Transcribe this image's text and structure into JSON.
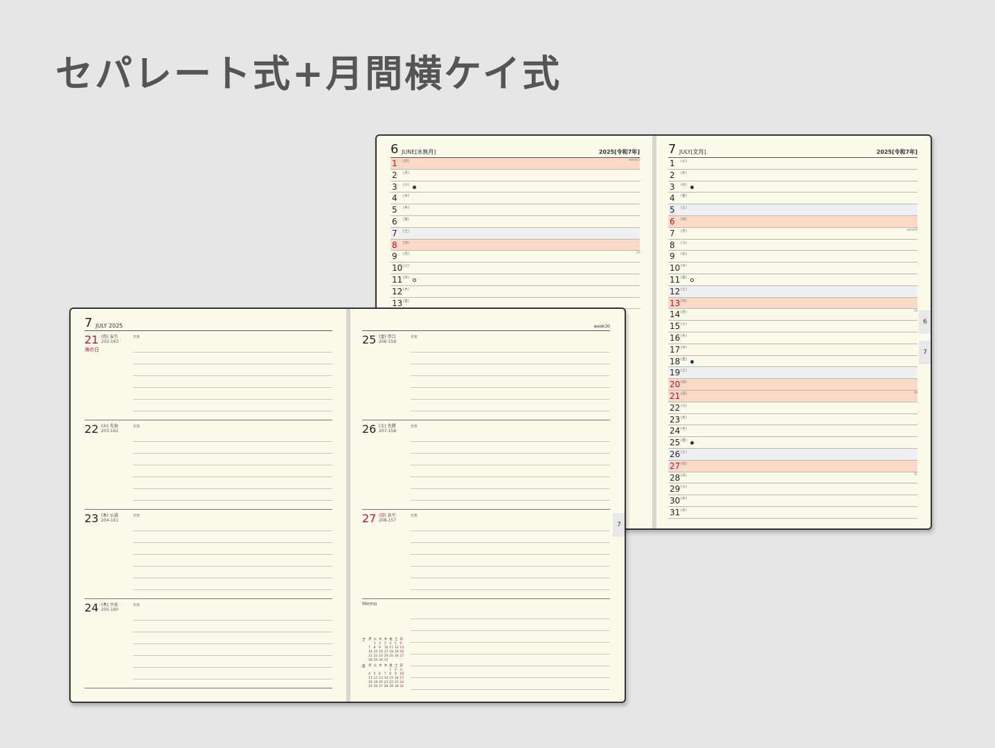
{
  "headline": "セパレート式+月間横ケイ式",
  "monthly": {
    "left": {
      "month": "6",
      "name": "JUNE[水無月]",
      "year": "2025[令和7年]",
      "rows": [
        {
          "d": "1",
          "w": "(日)",
          "h": true,
          "s": false,
          "moon": "",
          "wk": "week23"
        },
        {
          "d": "2",
          "w": "(月)",
          "h": false,
          "s": false,
          "moon": "",
          "wk": ""
        },
        {
          "d": "3",
          "w": "(火)",
          "h": false,
          "s": false,
          "moon": "full",
          "wk": ""
        },
        {
          "d": "4",
          "w": "(水)",
          "h": false,
          "s": false,
          "moon": "",
          "wk": ""
        },
        {
          "d": "5",
          "w": "(木)",
          "h": false,
          "s": false,
          "moon": "",
          "wk": ""
        },
        {
          "d": "6",
          "w": "(金)",
          "h": false,
          "s": false,
          "moon": "",
          "wk": ""
        },
        {
          "d": "7",
          "w": "(土)",
          "h": false,
          "s": true,
          "moon": "",
          "wk": ""
        },
        {
          "d": "8",
          "w": "(日)",
          "h": true,
          "s": false,
          "moon": "",
          "wk": ""
        },
        {
          "d": "9",
          "w": "(月)",
          "h": false,
          "s": false,
          "moon": "",
          "wk": "24"
        },
        {
          "d": "10",
          "w": "(火)",
          "h": false,
          "s": false,
          "moon": "",
          "wk": ""
        },
        {
          "d": "11",
          "w": "(水)",
          "h": false,
          "s": false,
          "moon": "new",
          "wk": ""
        },
        {
          "d": "12",
          "w": "(木)",
          "h": false,
          "s": false,
          "moon": "",
          "wk": ""
        },
        {
          "d": "13",
          "w": "(金)",
          "h": false,
          "s": false,
          "moon": "",
          "wk": ""
        }
      ]
    },
    "right": {
      "month": "7",
      "name": "JULY[文月]",
      "year": "2025[令和7年]",
      "rows": [
        {
          "d": "1",
          "w": "(火)",
          "h": false,
          "s": false,
          "moon": "",
          "wk": ""
        },
        {
          "d": "2",
          "w": "(水)",
          "h": false,
          "s": false,
          "moon": "",
          "wk": ""
        },
        {
          "d": "3",
          "w": "(木)",
          "h": false,
          "s": false,
          "moon": "full",
          "wk": ""
        },
        {
          "d": "4",
          "w": "(金)",
          "h": false,
          "s": false,
          "moon": "",
          "wk": ""
        },
        {
          "d": "5",
          "w": "(土)",
          "h": false,
          "s": true,
          "moon": "",
          "wk": ""
        },
        {
          "d": "6",
          "w": "(日)",
          "h": true,
          "s": false,
          "moon": "",
          "wk": ""
        },
        {
          "d": "7",
          "w": "(月)",
          "h": false,
          "s": false,
          "moon": "",
          "wk": "week28"
        },
        {
          "d": "8",
          "w": "(火)",
          "h": false,
          "s": false,
          "moon": "",
          "wk": ""
        },
        {
          "d": "9",
          "w": "(水)",
          "h": false,
          "s": false,
          "moon": "",
          "wk": ""
        },
        {
          "d": "10",
          "w": "(木)",
          "h": false,
          "s": false,
          "moon": "",
          "wk": ""
        },
        {
          "d": "11",
          "w": "(金)",
          "h": false,
          "s": false,
          "moon": "new",
          "wk": ""
        },
        {
          "d": "12",
          "w": "(土)",
          "h": false,
          "s": true,
          "moon": "",
          "wk": ""
        },
        {
          "d": "13",
          "w": "(日)",
          "h": true,
          "s": false,
          "moon": "",
          "wk": ""
        },
        {
          "d": "14",
          "w": "(月)",
          "h": false,
          "s": false,
          "moon": "",
          "wk": "29"
        },
        {
          "d": "15",
          "w": "(火)",
          "h": false,
          "s": false,
          "moon": "",
          "wk": ""
        },
        {
          "d": "16",
          "w": "(水)",
          "h": false,
          "s": false,
          "moon": "",
          "wk": ""
        },
        {
          "d": "17",
          "w": "(木)",
          "h": false,
          "s": false,
          "moon": "",
          "wk": ""
        },
        {
          "d": "18",
          "w": "(金)",
          "h": false,
          "s": false,
          "moon": "full",
          "wk": ""
        },
        {
          "d": "19",
          "w": "(土)",
          "h": false,
          "s": true,
          "moon": "",
          "wk": ""
        },
        {
          "d": "20",
          "w": "(日)",
          "h": true,
          "s": false,
          "moon": "",
          "wk": ""
        },
        {
          "d": "21",
          "w": "(月)",
          "h": true,
          "s": false,
          "moon": "",
          "wk": "30"
        },
        {
          "d": "22",
          "w": "(火)",
          "h": false,
          "s": false,
          "moon": "",
          "wk": ""
        },
        {
          "d": "23",
          "w": "(水)",
          "h": false,
          "s": false,
          "moon": "",
          "wk": ""
        },
        {
          "d": "24",
          "w": "(木)",
          "h": false,
          "s": false,
          "moon": "",
          "wk": ""
        },
        {
          "d": "25",
          "w": "(金)",
          "h": false,
          "s": false,
          "moon": "full",
          "wk": ""
        },
        {
          "d": "26",
          "w": "(土)",
          "h": false,
          "s": true,
          "moon": "",
          "wk": ""
        },
        {
          "d": "27",
          "w": "(日)",
          "h": true,
          "s": false,
          "moon": "",
          "wk": ""
        },
        {
          "d": "28",
          "w": "(月)",
          "h": false,
          "s": false,
          "moon": "",
          "wk": "31"
        },
        {
          "d": "29",
          "w": "(火)",
          "h": false,
          "s": false,
          "moon": "",
          "wk": ""
        },
        {
          "d": "30",
          "w": "(水)",
          "h": false,
          "s": false,
          "moon": "",
          "wk": ""
        },
        {
          "d": "31",
          "w": "(木)",
          "h": false,
          "s": false,
          "moon": "",
          "wk": ""
        }
      ]
    },
    "tabs": [
      "6",
      "7"
    ]
  },
  "weekly": {
    "month": "7",
    "title": "JULY 2025",
    "week": "week30",
    "weather": "天気",
    "left_days": [
      {
        "d": "21",
        "w": "(月)",
        "r": "友引",
        "n": "202-163",
        "red": true,
        "event": "海の日"
      },
      {
        "d": "22",
        "w": "(火)",
        "r": "先負",
        "n": "203-162",
        "red": false,
        "event": ""
      },
      {
        "d": "23",
        "w": "(水)",
        "r": "仏滅",
        "n": "204-161",
        "red": false,
        "event": ""
      },
      {
        "d": "24",
        "w": "(木)",
        "r": "大安",
        "n": "205-160",
        "red": false,
        "event": ""
      }
    ],
    "right_days": [
      {
        "d": "25",
        "w": "(金)",
        "r": "赤口",
        "n": "206-159",
        "red": false,
        "event": ""
      },
      {
        "d": "26",
        "w": "(土)",
        "r": "先勝",
        "n": "207-158",
        "red": false,
        "event": ""
      },
      {
        "d": "27",
        "w": "(日)",
        "r": "友引",
        "n": "208-157",
        "red": true,
        "event": ""
      }
    ],
    "memo": "Memo",
    "tab": "7",
    "minical": [
      {
        "m": "7",
        "cells": [
          "月",
          "火",
          "水",
          "木",
          "金",
          "土",
          "日",
          "",
          "1",
          "2",
          "3",
          "4",
          "5",
          "6",
          "7",
          "8",
          "9",
          "10",
          "11",
          "12",
          "13",
          "14",
          "15",
          "16",
          "17",
          "18",
          "19",
          "20",
          "21",
          "22",
          "23",
          "24",
          "25",
          "26",
          "27",
          "28",
          "29",
          "30",
          "31",
          "",
          "",
          ""
        ]
      },
      {
        "m": "8",
        "cells": [
          "月",
          "火",
          "水",
          "木",
          "金",
          "土",
          "日",
          "",
          "",
          "",
          "",
          "1",
          "2",
          "3",
          "4",
          "5",
          "6",
          "7",
          "8",
          "9",
          "10",
          "11",
          "12",
          "13",
          "14",
          "15",
          "16",
          "17",
          "18",
          "19",
          "20",
          "21",
          "22",
          "23",
          "24",
          "25",
          "26",
          "27",
          "28",
          "29",
          "30",
          "31"
        ]
      }
    ]
  }
}
